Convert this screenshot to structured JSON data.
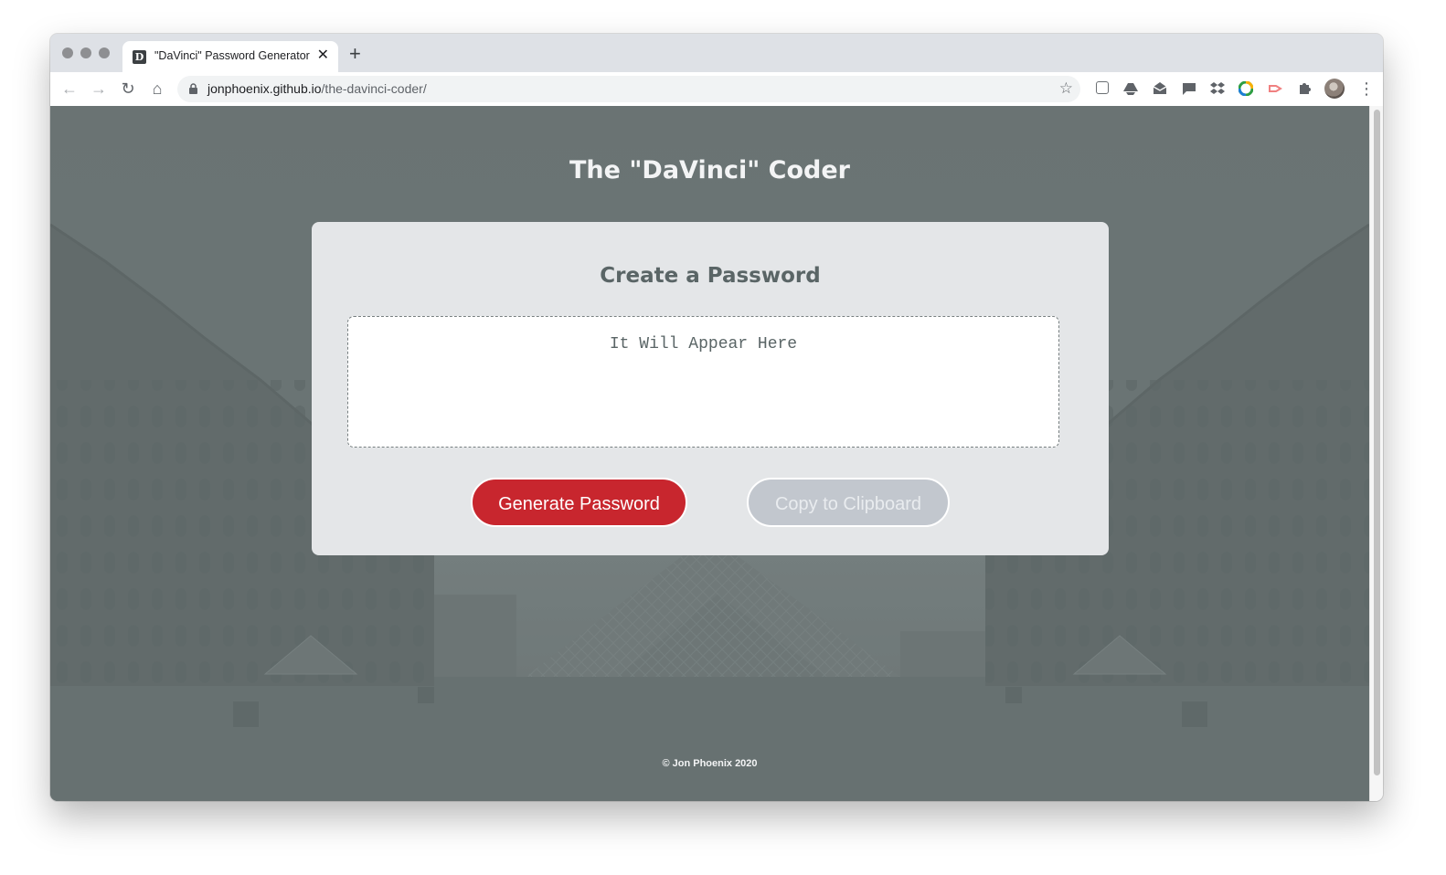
{
  "browser": {
    "tab_title": "\"DaVinci\" Password Generator",
    "tab_favicon_letter": "D",
    "url_host": "jonphoenix.github.io",
    "url_path": "/the-davinci-coder/",
    "icons": {
      "back": "arrow-left-icon",
      "forward": "arrow-right-icon",
      "reload": "reload-icon",
      "home": "home-icon",
      "lock": "lock-icon",
      "bookmark": "star-icon",
      "menu": "more-vertical-icon"
    }
  },
  "page": {
    "title": "The \"DaVinci\" Coder",
    "card": {
      "heading": "Create a Password",
      "output_placeholder": "It Will Appear Here",
      "generate_label": "Generate Password",
      "copy_label": "Copy to Clipboard"
    },
    "footer": "© Jon Phoenix 2020"
  },
  "colors": {
    "accent_red": "#c8262e",
    "disabled_button": "#c2c7ce",
    "card_bg": "#e4e6e8",
    "page_overlay": "#6a7474"
  }
}
